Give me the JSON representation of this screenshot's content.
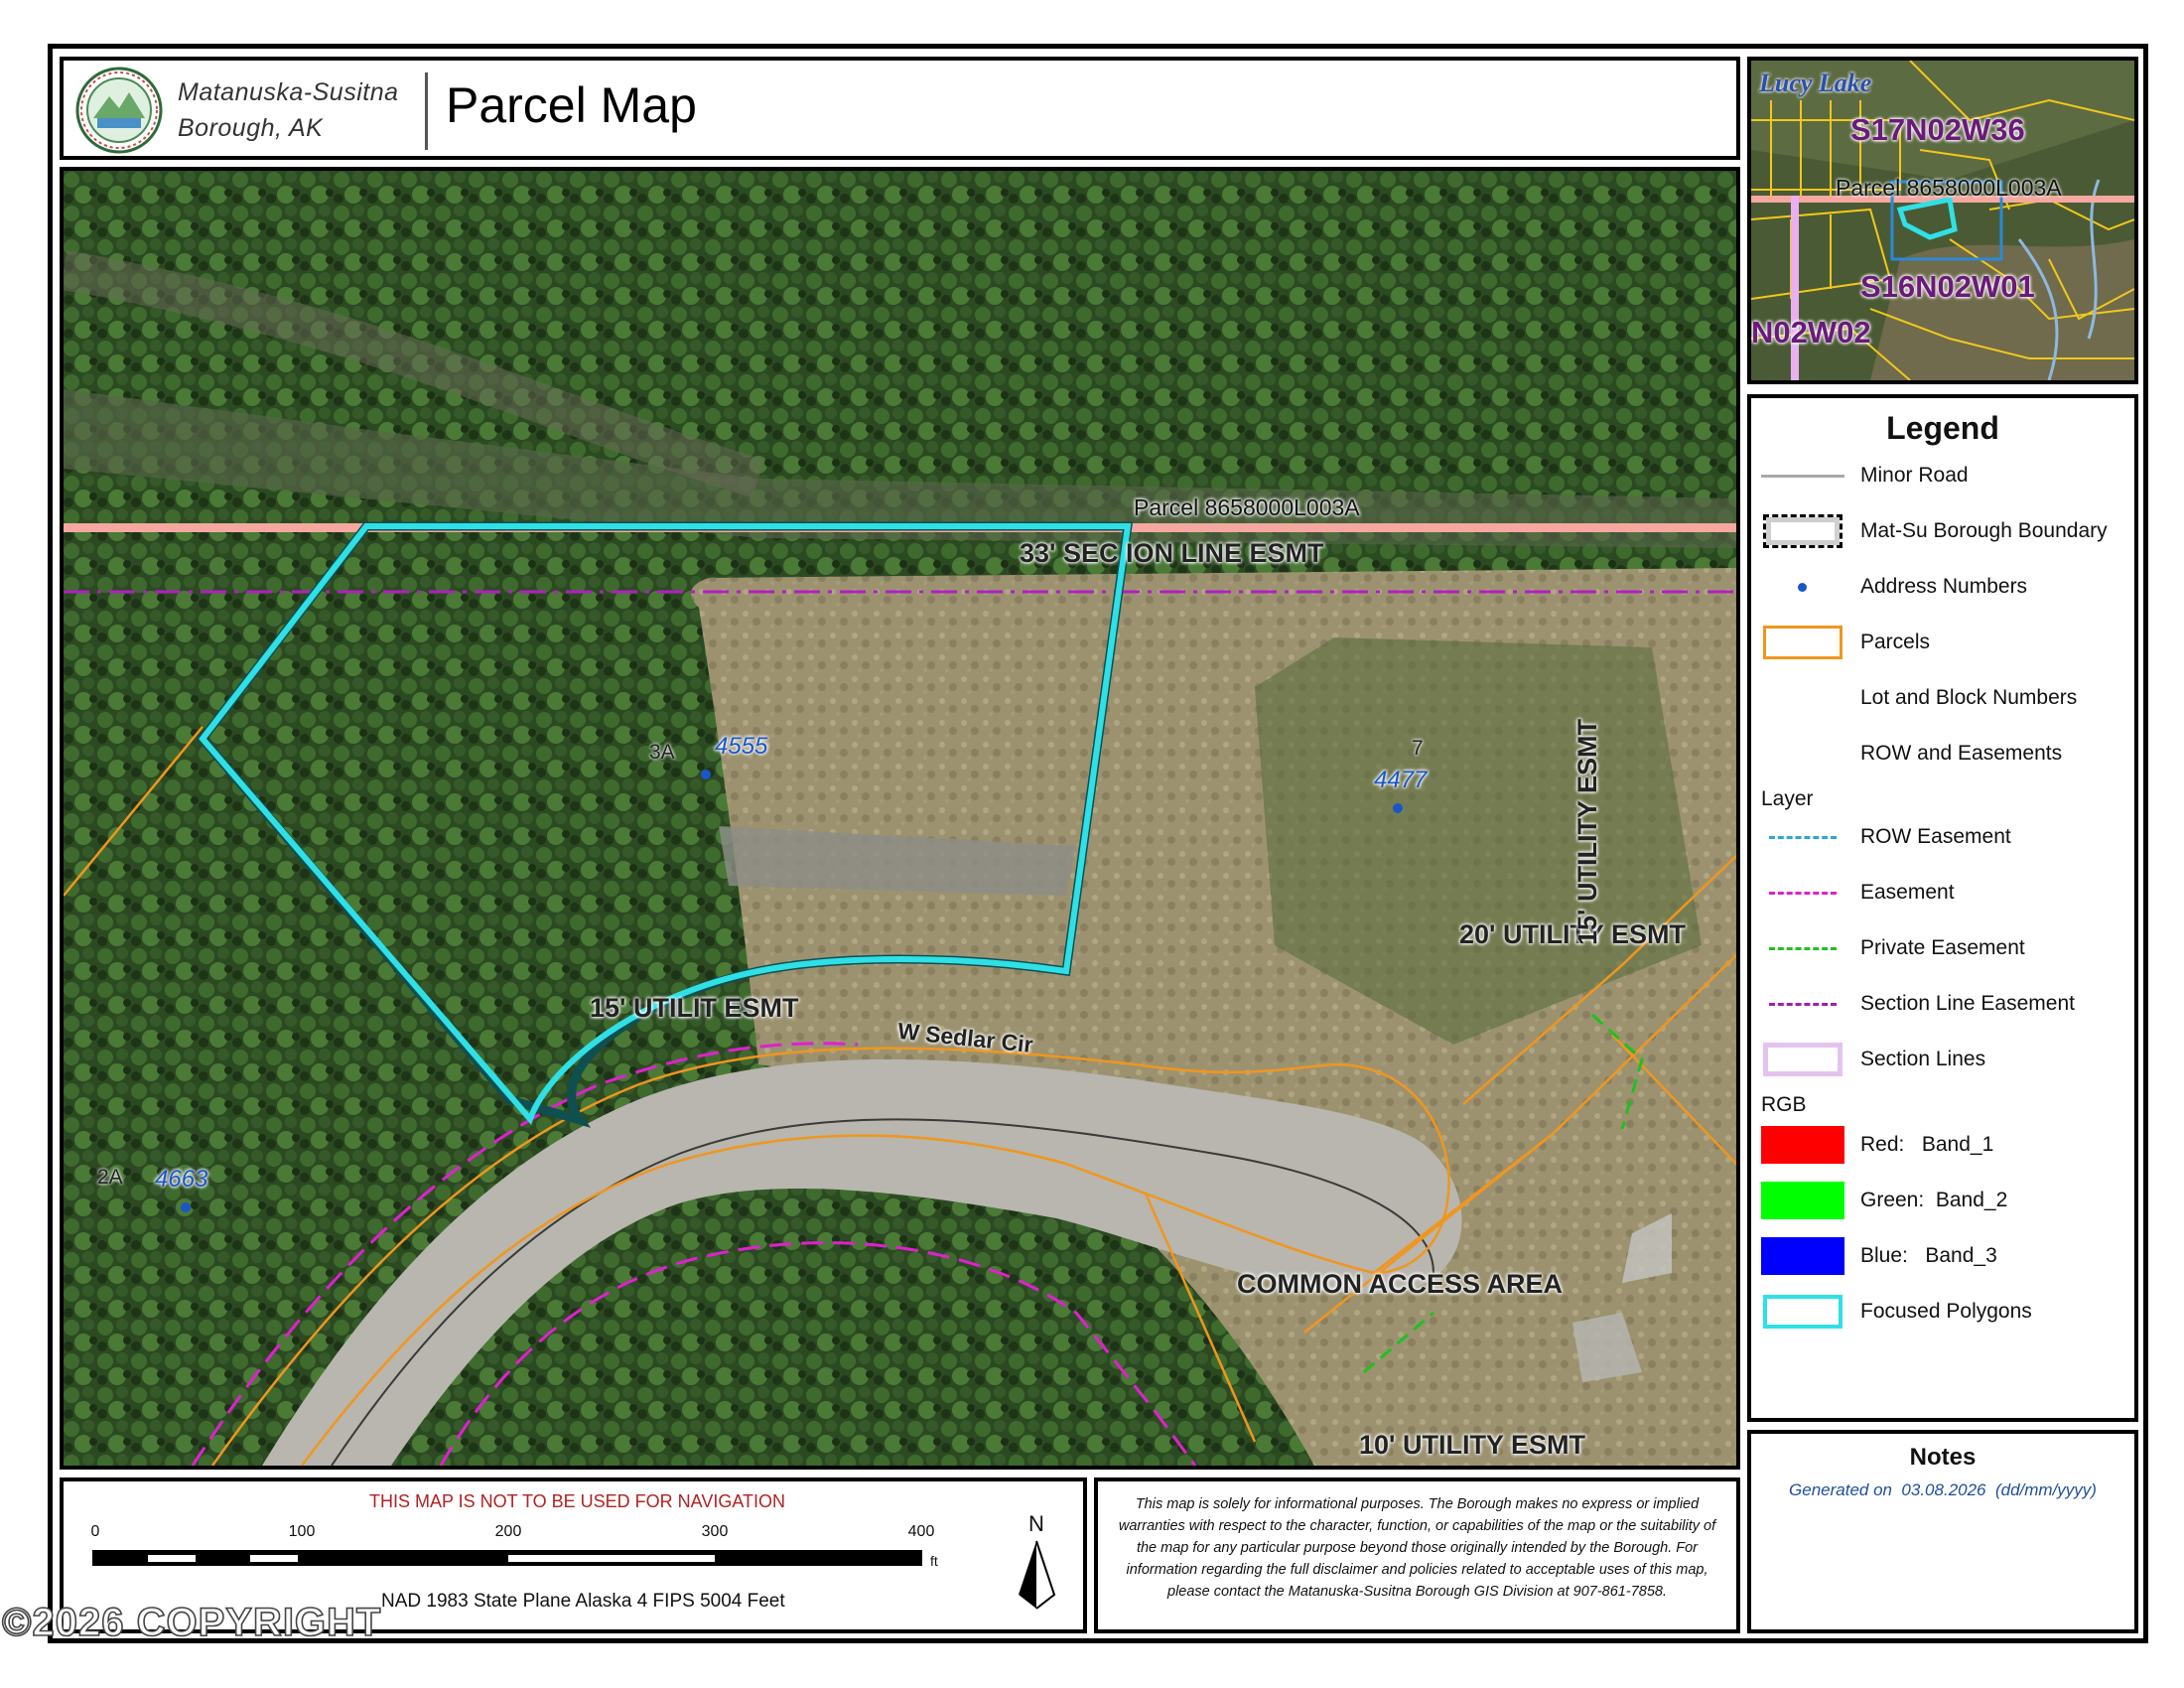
{
  "header": {
    "org_line1": "Matanuska-Susitna",
    "org_line2": "Borough, AK",
    "title": "Parcel Map"
  },
  "map": {
    "parcel_label": "Parcel 8658000L003A",
    "easement_labels": [
      "33' SEC ION LINE ESMT",
      "20' UTILITY ESMT",
      "15' UTILITY ESMT",
      "15' UTILIT ESMT",
      "COMMON ACCESS AREA",
      "10' UTILITY ESMT"
    ],
    "road_name": "W Sedlar Cir",
    "lots": [
      {
        "lot": "3A",
        "address": "4555"
      },
      {
        "lot": "7",
        "address": "4477"
      },
      {
        "lot": "2A",
        "address": "4663"
      }
    ],
    "colors": {
      "focused_polygon": "#2fe0e6",
      "parcel_line": "#f0961e",
      "easement": "#e020d0",
      "section_line_easement": "#b020c0",
      "section_line": "#f5a8a0",
      "private_easement": "#20c020"
    }
  },
  "inset": {
    "lake_label": "Lucy Lake",
    "section_labels": [
      "S17N02W36",
      "S16N02W01",
      "N02W02"
    ],
    "parcel_label": "Parcel 8658000L003A"
  },
  "legend": {
    "title": "Legend",
    "items": [
      {
        "label": "Minor Road",
        "icon": "minor-road-line"
      },
      {
        "label": "Mat-Su Borough Boundary",
        "icon": "boundary-swatch"
      },
      {
        "label": "Address Numbers",
        "icon": "address-dot"
      },
      {
        "label": "Parcels",
        "icon": "parcel-swatch"
      },
      {
        "label": "Lot and Block Numbers",
        "icon": "none"
      },
      {
        "label": "ROW and Easements",
        "icon": "none"
      }
    ],
    "layer_heading": "Layer",
    "layer_items": [
      {
        "label": "ROW Easement",
        "color": "#2aa8d8"
      },
      {
        "label": "Easement",
        "color": "#e020d0"
      },
      {
        "label": "Private Easement",
        "color": "#20c020"
      },
      {
        "label": "Section Line Easement",
        "color": "#a020b0"
      },
      {
        "label": "Section Lines",
        "color": "#e4c4ee"
      }
    ],
    "rgb_heading": "RGB",
    "rgb_items": [
      {
        "label": "Red:   Band_1",
        "color": "#ff0000"
      },
      {
        "label": "Green:  Band_2",
        "color": "#00ff00"
      },
      {
        "label": "Blue:   Band_3",
        "color": "#0000ff"
      }
    ],
    "focused_label": "Focused Polygons",
    "focused_color": "#2fe0e6"
  },
  "notes": {
    "title": "Notes",
    "generated": "Generated on  03.08.2026  (dd/mm/yyyy)"
  },
  "scale": {
    "warning": "THIS MAP IS NOT TO BE USED FOR NAVIGATION",
    "ticks": [
      "0",
      "100",
      "200",
      "300",
      "400"
    ],
    "unit": "ft",
    "projection": "NAD 1983 State Plane Alaska 4 FIPS 5004 Feet",
    "north": "N"
  },
  "disclaimer": "This map is solely for informational purposes. The Borough makes no express or implied warranties with respect to the character, function, or capabilities of the map or the suitability of the map for any particular purpose beyond those originally intended by the Borough. For information regarding the full disclaimer and policies related to acceptable uses of this map, please contact the Matanuska-Susitna Borough GIS Division at 907-861-7858.",
  "watermark": "©2026 COPYRIGHT"
}
